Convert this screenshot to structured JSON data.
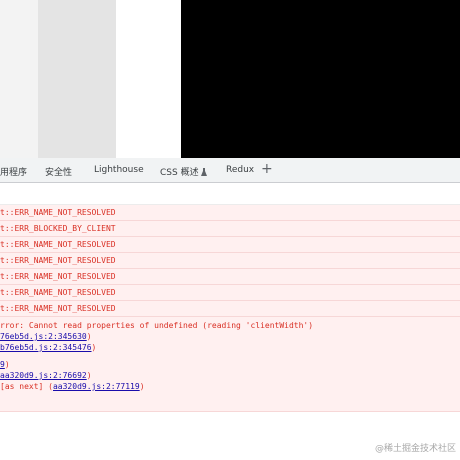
{
  "tabs": [
    {
      "label": "用程序"
    },
    {
      "label": "安全性"
    },
    {
      "label": "Lighthouse"
    },
    {
      "label": "CSS 概述"
    },
    {
      "label": "Redux"
    }
  ],
  "add_tab_symbol": "+",
  "console": {
    "rows": [
      "t::ERR_NAME_NOT_RESOLVED",
      "t::ERR_BLOCKED_BY_CLIENT",
      "t::ERR_NAME_NOT_RESOLVED",
      "t::ERR_NAME_NOT_RESOLVED",
      "t::ERR_NAME_NOT_RESOLVED",
      "t::ERR_NAME_NOT_RESOLVED",
      "t::ERR_NAME_NOT_RESOLVED"
    ],
    "error": {
      "message": "rror: Cannot read properties of undefined (reading 'clientWidth')",
      "stack1_link": "76eb5d.js:2:345630",
      "stack1_suffix": ")",
      "stack2_link": "b76eb5d.js:2:345476",
      "stack2_suffix": ")",
      "stack3_link": "9",
      "stack3_suffix": ")",
      "stack4_link": "aa320d9.js:2:76692",
      "stack4_suffix": ")",
      "stack5_prefix": " [as next] (",
      "stack5_link": "aa320d9.js:2:77119",
      "stack5_suffix": ")"
    }
  },
  "watermark": "@稀土掘金技术社区"
}
